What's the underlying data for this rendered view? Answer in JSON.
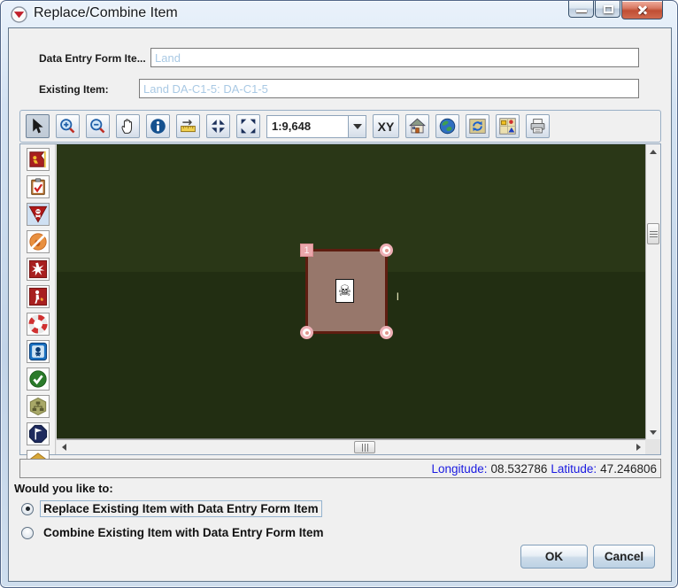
{
  "window": {
    "title": "Replace/Combine Item"
  },
  "form": {
    "field1_label": "Data Entry Form Ite...",
    "field1_value": "Land",
    "field2_label": "Existing Item:",
    "field2_value": "Land DA-C1-5: DA-C1-5"
  },
  "toolbar": {
    "scale_value": "1:9,648",
    "xy_label": "XY",
    "icons": [
      "pointer-icon",
      "zoom-in-icon",
      "zoom-out-icon",
      "pan-hand-icon",
      "info-icon",
      "measure-icon",
      "zoom-collapse-icon",
      "zoom-extent-icon",
      "scale-combo",
      "xy-button",
      "home-icon",
      "globe-icon",
      "map-refresh-icon",
      "map-overview-icon",
      "print-icon"
    ]
  },
  "sidebar": {
    "icons": [
      "command-post-icon",
      "checklist-icon",
      "hazard-skull-icon",
      "no-fire-icon",
      "explosion-icon",
      "evacuee-icon",
      "lifebuoy-icon",
      "decon-skull-icon",
      "check-icon",
      "org-chart-icon",
      "flag-octagon-icon",
      "pentagon-icon"
    ]
  },
  "map": {
    "vertex_label": "1",
    "feature_label": "l",
    "skull_glyph": "☠",
    "polygon_fill": "#97776b",
    "polygon_border": "#5e1d10",
    "bg_top": "#2a3717",
    "bg_bottom": "#222e12"
  },
  "statusbar": {
    "longitude_label": "Longitude:",
    "longitude_value": "08.532786",
    "latitude_label": "Latitude:",
    "latitude_value": "47.246806"
  },
  "prompt": {
    "question": "Would you like to:",
    "options": [
      {
        "label": "Replace Existing Item with Data Entry Form Item",
        "selected": true
      },
      {
        "label": "Combine Existing Item with Data Entry Form Item",
        "selected": false
      }
    ]
  },
  "actions": {
    "ok": "OK",
    "cancel": "Cancel"
  }
}
